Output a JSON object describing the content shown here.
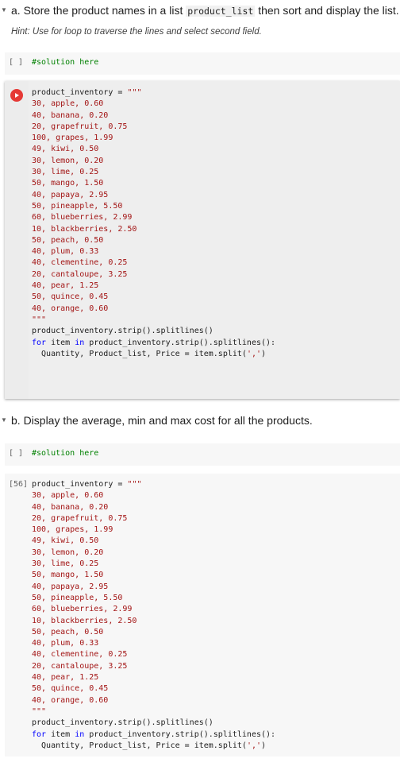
{
  "section_a": {
    "title_pre": "a. Store the product names in a list ",
    "title_code": "product_list",
    "title_post": " then sort and display the list.",
    "hint": "Hint: Use for loop to traverse the lines and select second field."
  },
  "section_b": {
    "title": "b. Display the average, min and max cost for all the products."
  },
  "cell_empty": {
    "prompt": "[ ]",
    "comment": "#solution here"
  },
  "cell_executed": {
    "prompt": "[56]"
  },
  "code": {
    "line1_var": "product_inventory = ",
    "line1_str": "\"\"\"",
    "data_lines": [
      "30, apple, 0.60",
      "40, banana, 0.20",
      "20, grapefruit, 0.75",
      "100, grapes, 1.99",
      "49, kiwi, 0.50",
      "30, lemon, 0.20",
      "30, lime, 0.25",
      "50, mango, 1.50",
      "40, papaya, 2.95",
      "50, pineapple, 5.50",
      "60, blueberries, 2.99",
      "10, blackberries, 2.50",
      "50, peach, 0.50",
      "40, plum, 0.33",
      "40, clementine, 0.25",
      "20, cantaloupe, 3.25",
      "40, pear, 1.25",
      "50, quince, 0.45",
      "40, orange, 0.60"
    ],
    "close_str": "\"\"\"",
    "strip_line": "product_inventory.strip().splitlines()",
    "for_kw": "for",
    "for_item": " item ",
    "in_kw": "in",
    "for_rest": " product_inventory.strip().splitlines():",
    "split_pre": "  Quantity, Product_list, Price = item.split(",
    "split_arg": "','",
    "split_post": ")"
  }
}
